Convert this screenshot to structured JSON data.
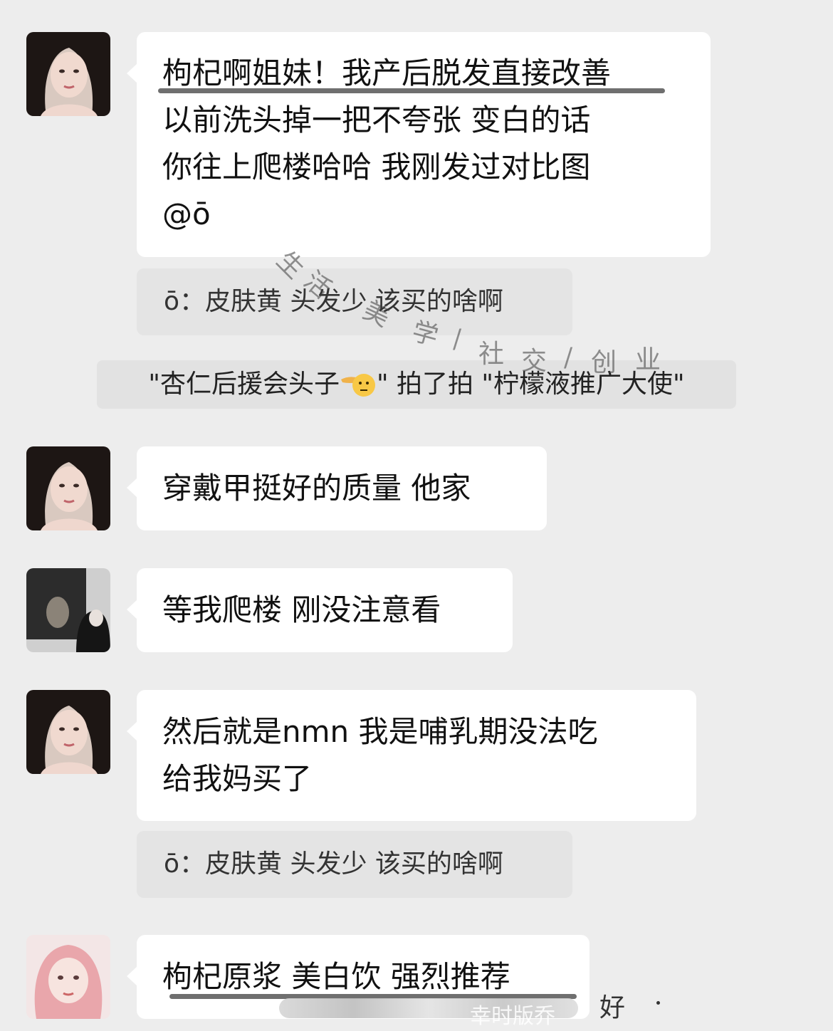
{
  "messages": [
    {
      "lines": [
        "枸杞啊姐妹！我产后脱发直接改善",
        " 以前洗头掉一把不夸张 变白的话",
        "你往上爬楼哈哈 我刚发过对比图",
        "@ō"
      ]
    },
    {
      "quote": "ō：皮肤黄 头发少 该买的啥啊"
    },
    {
      "system": [
        "\"杏仁后援会头子",
        "\" 拍了拍 \"柠檬液推广大使\""
      ]
    },
    {
      "lines": [
        "穿戴甲挺好的质量 他家"
      ]
    },
    {
      "lines": [
        "等我爬楼 刚没注意看"
      ]
    },
    {
      "lines": [
        "然后就是nmn 我是哺乳期没法吃",
        "给我妈买了"
      ]
    },
    {
      "quote": "ō：皮肤黄 头发少 该买的啥啊"
    },
    {
      "lines": [
        "枸杞原浆 美白饮 强烈推荐"
      ]
    }
  ],
  "watermark": {
    "chars": [
      "生",
      "活",
      "美",
      "学",
      "/",
      "社",
      "交",
      "/",
      "创",
      "业"
    ],
    "footer_text": "幸时版乔",
    "footer_char": "好"
  },
  "icons": {
    "avatar_1": "woman-dark-hair-avatar",
    "avatar_2": "photo-frame-avatar",
    "avatar_3": "pink-hair-avatar",
    "emoji": "pointing-hand-face-emoji"
  }
}
